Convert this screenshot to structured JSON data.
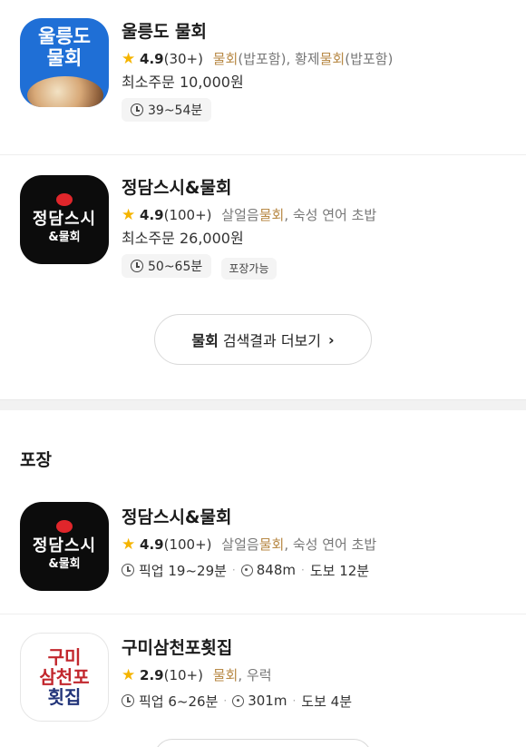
{
  "delivery": [
    {
      "logo": {
        "line1": "울릉도",
        "line2": "물회",
        "style": "blue"
      },
      "name": "울릉도 물회",
      "rating": "4.9",
      "review_count": "(30+)",
      "menu": [
        {
          "text": "물회",
          "hl": true
        },
        {
          "text": "(밥포함), 황제",
          "hl": false
        },
        {
          "text": "물회",
          "hl": true
        },
        {
          "text": "(밥포함)",
          "hl": false
        }
      ],
      "min_order": "최소주문 10,000원",
      "time": "39~54분",
      "badges": []
    },
    {
      "logo": {
        "line1": "정담스시",
        "line2": "&물회",
        "style": "black"
      },
      "name": "정담스시&물회",
      "rating": "4.9",
      "review_count": "(100+)",
      "menu": [
        {
          "text": "살얼음",
          "hl": false
        },
        {
          "text": "물회",
          "hl": true
        },
        {
          "text": ", 숙성 연어 초밥",
          "hl": false
        }
      ],
      "min_order": "최소주문 26,000원",
      "time": "50~65분",
      "badges": [
        "포장가능"
      ]
    }
  ],
  "more_button": {
    "keyword": "물회",
    "label": "검색결과 더보기",
    "chevron": "›"
  },
  "pickup_section": {
    "title": "포장",
    "items": [
      {
        "logo": {
          "line1": "정담스시",
          "line2": "&물회",
          "style": "black"
        },
        "name": "정담스시&물회",
        "rating": "4.9",
        "review_count": "(100+)",
        "menu": [
          {
            "text": "살얼음",
            "hl": false
          },
          {
            "text": "물회",
            "hl": true
          },
          {
            "text": ", 숙성 연어 초밥",
            "hl": false
          }
        ],
        "pickup_time": "픽업 19~29분",
        "distance": "848m",
        "walk": "도보 12분"
      },
      {
        "logo": {
          "line1": "구미",
          "line2": "삼천포",
          "line3": "횟집",
          "style": "white"
        },
        "name": "구미삼천포횟집",
        "rating": "2.9",
        "review_count": "(10+)",
        "menu": [
          {
            "text": "물회",
            "hl": true
          },
          {
            "text": ", 우럭",
            "hl": false
          }
        ],
        "pickup_time": "픽업 6~26분",
        "distance": "301m",
        "walk": "도보 4분"
      }
    ]
  },
  "colors": {
    "star": "#f5b400",
    "highlight": "#b88a47",
    "logo_blue": "#1f6fd6",
    "logo_red": "#c2272d",
    "logo_navy": "#23357a"
  },
  "icons": {
    "star": "star-icon",
    "clock": "clock-icon",
    "pin": "location-pin-icon",
    "chevron": "chevron-right-icon"
  }
}
